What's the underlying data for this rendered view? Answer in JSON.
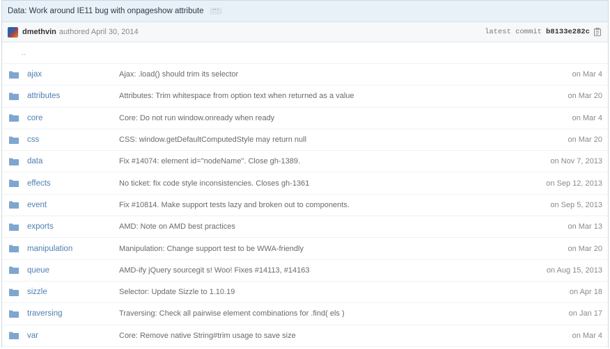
{
  "commit": {
    "title": "Data: Work around IE11 bug with onpageshow attribute",
    "ellipsis": "···",
    "author": "dmethvin",
    "authored": "authored April 30, 2014",
    "latest_label": "latest commit",
    "sha": "b8133e282c"
  },
  "parent_link": "..",
  "colors": {
    "folder": "#7fa6cf",
    "link": "#4f7fb0",
    "header_bg": "#e9f1f8"
  },
  "files": [
    {
      "name": "ajax",
      "message": "Ajax: .load() should trim its selector",
      "age": "on Mar 4"
    },
    {
      "name": "attributes",
      "message": "Attributes: Trim whitespace from option text when returned as a value",
      "age": "on Mar 20"
    },
    {
      "name": "core",
      "message": "Core: Do not run window.onready when ready",
      "age": "on Mar 4"
    },
    {
      "name": "css",
      "message": "CSS: window.getDefaultComputedStyle may return null",
      "age": "on Mar 20"
    },
    {
      "name": "data",
      "message": "Fix #14074: element id=\"nodeName\". Close gh-1389.",
      "age": "on Nov 7, 2013"
    },
    {
      "name": "effects",
      "message": "No ticket: fix code style inconsistencies. Closes gh-1361",
      "age": "on Sep 12, 2013"
    },
    {
      "name": "event",
      "message": "Fix #10814. Make support tests lazy and broken out to components.",
      "age": "on Sep 5, 2013"
    },
    {
      "name": "exports",
      "message": "AMD: Note on AMD best practices",
      "age": "on Mar 13"
    },
    {
      "name": "manipulation",
      "message": "Manipulation: Change support test to be WWA-friendly",
      "age": "on Mar 20"
    },
    {
      "name": "queue",
      "message": "AMD-ify jQuery sourcegit s! Woo! Fixes #14113, #14163",
      "age": "on Aug 15, 2013"
    },
    {
      "name": "sizzle",
      "message": "Selector: Update Sizzle to 1.10.19",
      "age": "on Apr 18"
    },
    {
      "name": "traversing",
      "message": "Traversing: Check all pairwise element combinations for .find( els )",
      "age": "on Jan 17"
    },
    {
      "name": "var",
      "message": "Core: Remove native String#trim usage to save size",
      "age": "on Mar 4"
    }
  ]
}
